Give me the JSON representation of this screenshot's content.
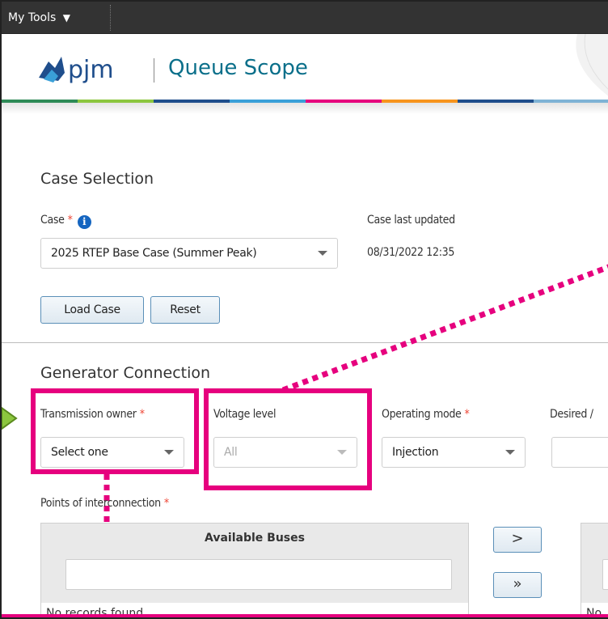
{
  "toolbar": {
    "my_tools_label": "My Tools",
    "caret": "▼"
  },
  "header": {
    "logo_text": "pjm",
    "app_title": "Queue Scope",
    "colorbar": [
      "#2e8b57",
      "#8cc63f",
      "#1f4e8c",
      "#3aa0d8",
      "#e6007e",
      "#f7941d",
      "#1f4e8c",
      "#7fb3d5"
    ]
  },
  "case_selection": {
    "title": "Case Selection",
    "case_label": "Case",
    "required_mark": "*",
    "info_icon": "info-icon",
    "case_value": "2025 RTEP Base Case (Summer Peak)",
    "last_updated_label": "Case last updated",
    "last_updated_value": "08/31/2022 12:35",
    "load_case_button": "Load Case",
    "reset_button": "Reset"
  },
  "generator_connection": {
    "title": "Generator Connection",
    "transmission_owner_label": "Transmission owner",
    "transmission_owner_value": "Select one",
    "voltage_level_label": "Voltage level",
    "voltage_level_value": "All",
    "operating_mode_label": "Operating mode",
    "operating_mode_value": "Injection",
    "desired_label": "Desired /",
    "required_mark": "*",
    "poi_label": "Points of interconnection",
    "available_buses_header": "Available Buses",
    "no_records": "No records found.",
    "no_records_right": "No",
    "move_one": ">",
    "move_all": "»"
  },
  "colors": {
    "accent": "#0a6f8a",
    "highlight": "#e6007e",
    "arrow": "#8cc63f"
  }
}
